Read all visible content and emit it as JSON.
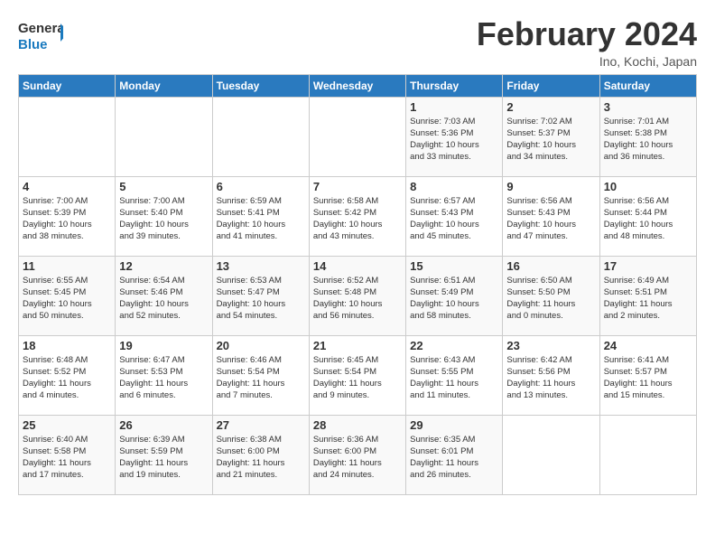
{
  "logo": {
    "line1": "General",
    "line2": "Blue"
  },
  "title": "February 2024",
  "subtitle": "Ino, Kochi, Japan",
  "days_header": [
    "Sunday",
    "Monday",
    "Tuesday",
    "Wednesday",
    "Thursday",
    "Friday",
    "Saturday"
  ],
  "weeks": [
    [
      {
        "day": "",
        "info": ""
      },
      {
        "day": "",
        "info": ""
      },
      {
        "day": "",
        "info": ""
      },
      {
        "day": "",
        "info": ""
      },
      {
        "day": "1",
        "info": "Sunrise: 7:03 AM\nSunset: 5:36 PM\nDaylight: 10 hours\nand 33 minutes."
      },
      {
        "day": "2",
        "info": "Sunrise: 7:02 AM\nSunset: 5:37 PM\nDaylight: 10 hours\nand 34 minutes."
      },
      {
        "day": "3",
        "info": "Sunrise: 7:01 AM\nSunset: 5:38 PM\nDaylight: 10 hours\nand 36 minutes."
      }
    ],
    [
      {
        "day": "4",
        "info": "Sunrise: 7:00 AM\nSunset: 5:39 PM\nDaylight: 10 hours\nand 38 minutes."
      },
      {
        "day": "5",
        "info": "Sunrise: 7:00 AM\nSunset: 5:40 PM\nDaylight: 10 hours\nand 39 minutes."
      },
      {
        "day": "6",
        "info": "Sunrise: 6:59 AM\nSunset: 5:41 PM\nDaylight: 10 hours\nand 41 minutes."
      },
      {
        "day": "7",
        "info": "Sunrise: 6:58 AM\nSunset: 5:42 PM\nDaylight: 10 hours\nand 43 minutes."
      },
      {
        "day": "8",
        "info": "Sunrise: 6:57 AM\nSunset: 5:43 PM\nDaylight: 10 hours\nand 45 minutes."
      },
      {
        "day": "9",
        "info": "Sunrise: 6:56 AM\nSunset: 5:43 PM\nDaylight: 10 hours\nand 47 minutes."
      },
      {
        "day": "10",
        "info": "Sunrise: 6:56 AM\nSunset: 5:44 PM\nDaylight: 10 hours\nand 48 minutes."
      }
    ],
    [
      {
        "day": "11",
        "info": "Sunrise: 6:55 AM\nSunset: 5:45 PM\nDaylight: 10 hours\nand 50 minutes."
      },
      {
        "day": "12",
        "info": "Sunrise: 6:54 AM\nSunset: 5:46 PM\nDaylight: 10 hours\nand 52 minutes."
      },
      {
        "day": "13",
        "info": "Sunrise: 6:53 AM\nSunset: 5:47 PM\nDaylight: 10 hours\nand 54 minutes."
      },
      {
        "day": "14",
        "info": "Sunrise: 6:52 AM\nSunset: 5:48 PM\nDaylight: 10 hours\nand 56 minutes."
      },
      {
        "day": "15",
        "info": "Sunrise: 6:51 AM\nSunset: 5:49 PM\nDaylight: 10 hours\nand 58 minutes."
      },
      {
        "day": "16",
        "info": "Sunrise: 6:50 AM\nSunset: 5:50 PM\nDaylight: 11 hours\nand 0 minutes."
      },
      {
        "day": "17",
        "info": "Sunrise: 6:49 AM\nSunset: 5:51 PM\nDaylight: 11 hours\nand 2 minutes."
      }
    ],
    [
      {
        "day": "18",
        "info": "Sunrise: 6:48 AM\nSunset: 5:52 PM\nDaylight: 11 hours\nand 4 minutes."
      },
      {
        "day": "19",
        "info": "Sunrise: 6:47 AM\nSunset: 5:53 PM\nDaylight: 11 hours\nand 6 minutes."
      },
      {
        "day": "20",
        "info": "Sunrise: 6:46 AM\nSunset: 5:54 PM\nDaylight: 11 hours\nand 7 minutes."
      },
      {
        "day": "21",
        "info": "Sunrise: 6:45 AM\nSunset: 5:54 PM\nDaylight: 11 hours\nand 9 minutes."
      },
      {
        "day": "22",
        "info": "Sunrise: 6:43 AM\nSunset: 5:55 PM\nDaylight: 11 hours\nand 11 minutes."
      },
      {
        "day": "23",
        "info": "Sunrise: 6:42 AM\nSunset: 5:56 PM\nDaylight: 11 hours\nand 13 minutes."
      },
      {
        "day": "24",
        "info": "Sunrise: 6:41 AM\nSunset: 5:57 PM\nDaylight: 11 hours\nand 15 minutes."
      }
    ],
    [
      {
        "day": "25",
        "info": "Sunrise: 6:40 AM\nSunset: 5:58 PM\nDaylight: 11 hours\nand 17 minutes."
      },
      {
        "day": "26",
        "info": "Sunrise: 6:39 AM\nSunset: 5:59 PM\nDaylight: 11 hours\nand 19 minutes."
      },
      {
        "day": "27",
        "info": "Sunrise: 6:38 AM\nSunset: 6:00 PM\nDaylight: 11 hours\nand 21 minutes."
      },
      {
        "day": "28",
        "info": "Sunrise: 6:36 AM\nSunset: 6:00 PM\nDaylight: 11 hours\nand 24 minutes."
      },
      {
        "day": "29",
        "info": "Sunrise: 6:35 AM\nSunset: 6:01 PM\nDaylight: 11 hours\nand 26 minutes."
      },
      {
        "day": "",
        "info": ""
      },
      {
        "day": "",
        "info": ""
      }
    ]
  ]
}
